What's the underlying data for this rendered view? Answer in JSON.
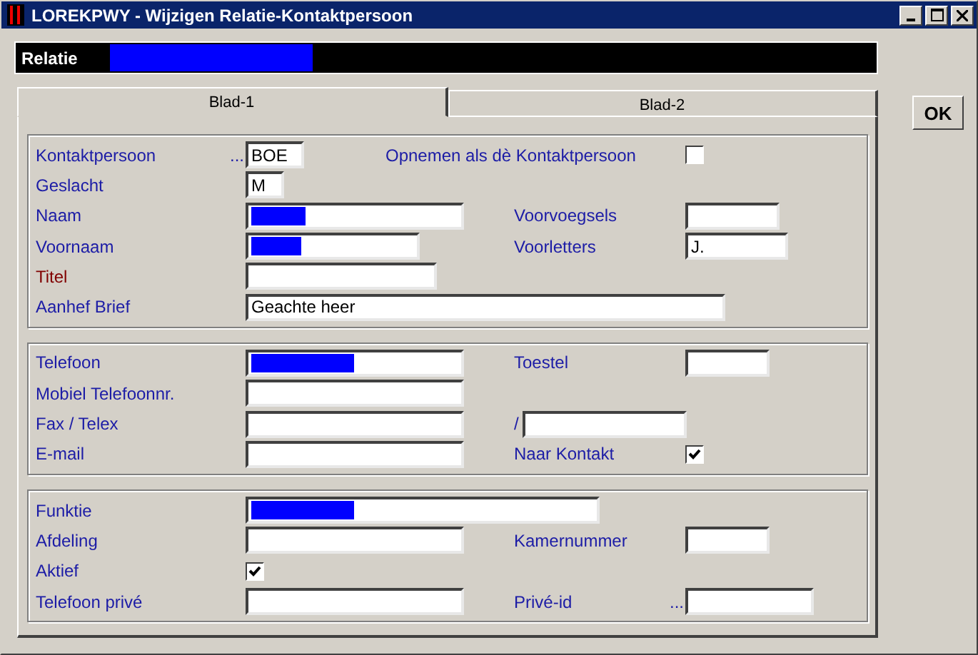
{
  "window": {
    "title": "LOREKPWY - Wijzigen Relatie-Kontaktpersoon"
  },
  "relatie": {
    "label": "Relatie",
    "redacted": true
  },
  "tabs": [
    {
      "label": "Blad-1",
      "selected": true
    },
    {
      "label": "Blad-2",
      "selected": false
    }
  ],
  "ok_button": "OK",
  "sections": [
    {
      "rows": [
        {
          "label": "Kontaktpersoon",
          "color": "#1c1ca6",
          "prefix": "...",
          "field": {
            "kind": "text",
            "value": "BOE",
            "redacted": false
          },
          "right": {
            "label": "Opnemen als dè Kontaktpersoon",
            "color": "#1c1ca6",
            "field": {
              "kind": "checkbox",
              "checked": false
            }
          }
        },
        {
          "label": "Geslacht",
          "color": "#1c1ca6",
          "field": {
            "kind": "text",
            "value": "M",
            "redacted": false
          }
        },
        {
          "label": "Naam",
          "color": "#1c1ca6",
          "field": {
            "kind": "text",
            "redacted": true
          },
          "right": {
            "label": "Voorvoegsels",
            "color": "#1c1ca6",
            "field": {
              "kind": "text",
              "redacted": false
            }
          }
        },
        {
          "label": "Voornaam",
          "color": "#1c1ca6",
          "field": {
            "kind": "text",
            "redacted": true
          },
          "right": {
            "label": "Voorletters",
            "color": "#1c1ca6",
            "field": {
              "kind": "text",
              "value": "J.",
              "redacted": false
            }
          }
        },
        {
          "label": "Titel",
          "color": "#800000",
          "field": {
            "kind": "text",
            "redacted": false
          }
        },
        {
          "label": "Aanhef Brief",
          "color": "#1c1ca6",
          "field": {
            "kind": "text",
            "value": "Geachte heer",
            "redacted": false
          }
        }
      ]
    },
    {
      "rows": [
        {
          "label": "Telefoon",
          "color": "#1c1ca6",
          "field": {
            "kind": "text",
            "redacted": true
          },
          "right": {
            "label": "Toestel",
            "color": "#1c1ca6",
            "field": {
              "kind": "text",
              "redacted": false
            }
          }
        },
        {
          "label": "Mobiel Telefoonnr.",
          "color": "#1c1ca6",
          "field": {
            "kind": "text",
            "redacted": false
          }
        },
        {
          "label": "Fax / Telex",
          "color": "#1c1ca6",
          "field": {
            "kind": "text",
            "redacted": false
          },
          "right": {
            "label": "/",
            "color": "#1c1ca6",
            "field": {
              "kind": "text",
              "redacted": false
            }
          }
        },
        {
          "label": "E-mail",
          "color": "#1c1ca6",
          "field": {
            "kind": "text",
            "redacted": false
          },
          "right": {
            "label": "Naar Kontakt",
            "color": "#1c1ca6",
            "field": {
              "kind": "checkbox",
              "checked": true
            }
          }
        }
      ]
    },
    {
      "rows": [
        {
          "label": "Funktie",
          "color": "#1c1ca6",
          "field": {
            "kind": "text",
            "redacted": true
          }
        },
        {
          "label": "Afdeling",
          "color": "#1c1ca6",
          "field": {
            "kind": "text",
            "redacted": false
          },
          "right": {
            "label": "Kamernummer",
            "color": "#1c1ca6",
            "field": {
              "kind": "text",
              "redacted": false
            }
          }
        },
        {
          "label": "Aktief",
          "color": "#1c1ca6",
          "field": {
            "kind": "checkbox",
            "checked": true
          }
        },
        {
          "label": "Telefoon privé",
          "color": "#1c1ca6",
          "field": {
            "kind": "text",
            "redacted": false
          },
          "right": {
            "label": "Privé-id",
            "color": "#1c1ca6",
            "prefix": "...",
            "field": {
              "kind": "text",
              "redacted": false
            }
          }
        }
      ]
    }
  ]
}
